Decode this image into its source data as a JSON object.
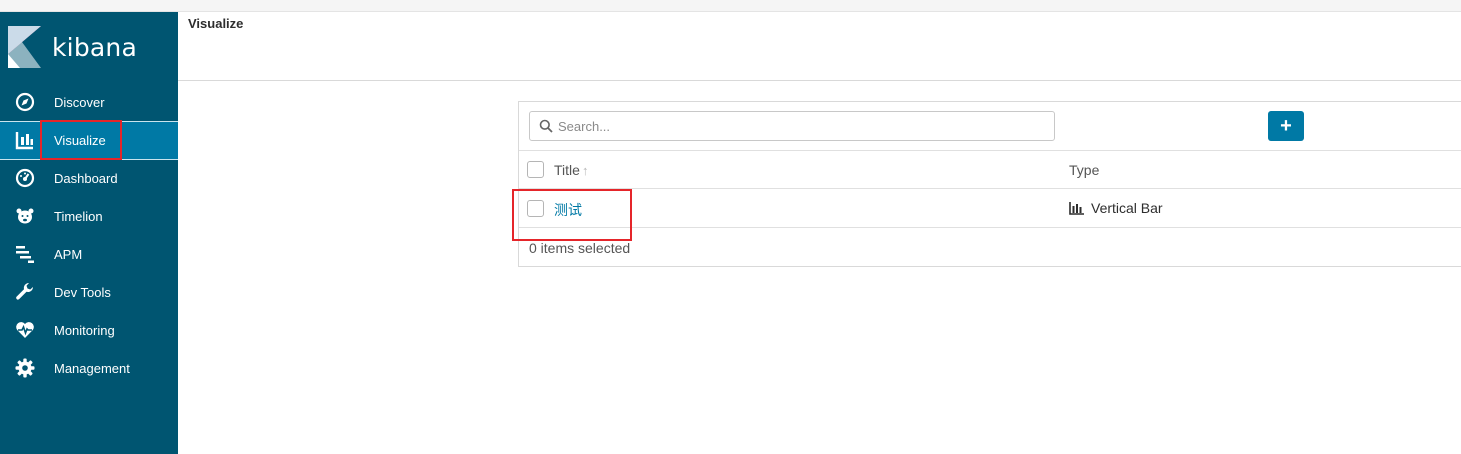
{
  "app": {
    "brand": "kibana",
    "page_title": "Visualize"
  },
  "sidebar": {
    "items": [
      {
        "label": "Discover",
        "icon": "compass-icon",
        "active": false
      },
      {
        "label": "Visualize",
        "icon": "bar-chart-icon",
        "active": true
      },
      {
        "label": "Dashboard",
        "icon": "dashboard-gauge-icon",
        "active": false
      },
      {
        "label": "Timelion",
        "icon": "timelion-bear-icon",
        "active": false
      },
      {
        "label": "APM",
        "icon": "apm-bars-icon",
        "active": false
      },
      {
        "label": "Dev Tools",
        "icon": "wrench-icon",
        "active": false
      },
      {
        "label": "Monitoring",
        "icon": "heartbeat-icon",
        "active": false
      },
      {
        "label": "Management",
        "icon": "gear-icon",
        "active": false
      }
    ]
  },
  "list": {
    "search_placeholder": "Search...",
    "add_button": "+",
    "columns": {
      "title": "Title",
      "sort_indicator": "↑",
      "type": "Type"
    },
    "rows": [
      {
        "title": "测试",
        "type": "Vertical Bar",
        "type_icon": "vertical-bar-chart-icon"
      }
    ],
    "selected_count": "0 items selected"
  },
  "colors": {
    "sidebar_bg": "#005571",
    "sidebar_active": "#0079a5",
    "accent": "#0079a5",
    "highlight_box": "#e5252a"
  }
}
